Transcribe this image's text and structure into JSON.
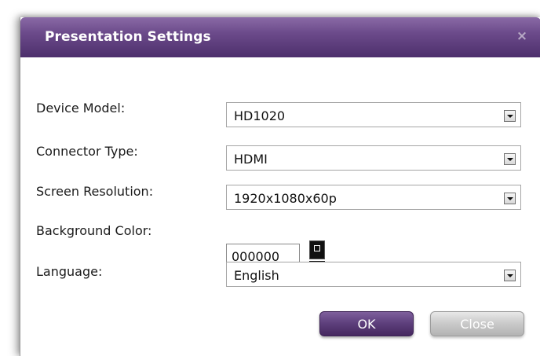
{
  "dialog": {
    "title": "Presentation Settings",
    "close_icon": "×"
  },
  "fields": {
    "device_model": {
      "label": "Device Model:",
      "value": "HD1020"
    },
    "connector_type": {
      "label": "Connector Type:",
      "value": "HDMI"
    },
    "screen_resolution": {
      "label": "Screen Resolution:",
      "value": "1920x1080x60p"
    },
    "background_color": {
      "label": "Background Color:",
      "value": "000000",
      "swatch_color": "#000000"
    },
    "language": {
      "label": "Language:",
      "value": "English"
    }
  },
  "buttons": {
    "ok_label": "OK",
    "close_label": "Close"
  },
  "colors": {
    "titlebar": "#5a3b7a",
    "ok_button": "#5c3e7b",
    "close_button": "#c9c9c9"
  }
}
